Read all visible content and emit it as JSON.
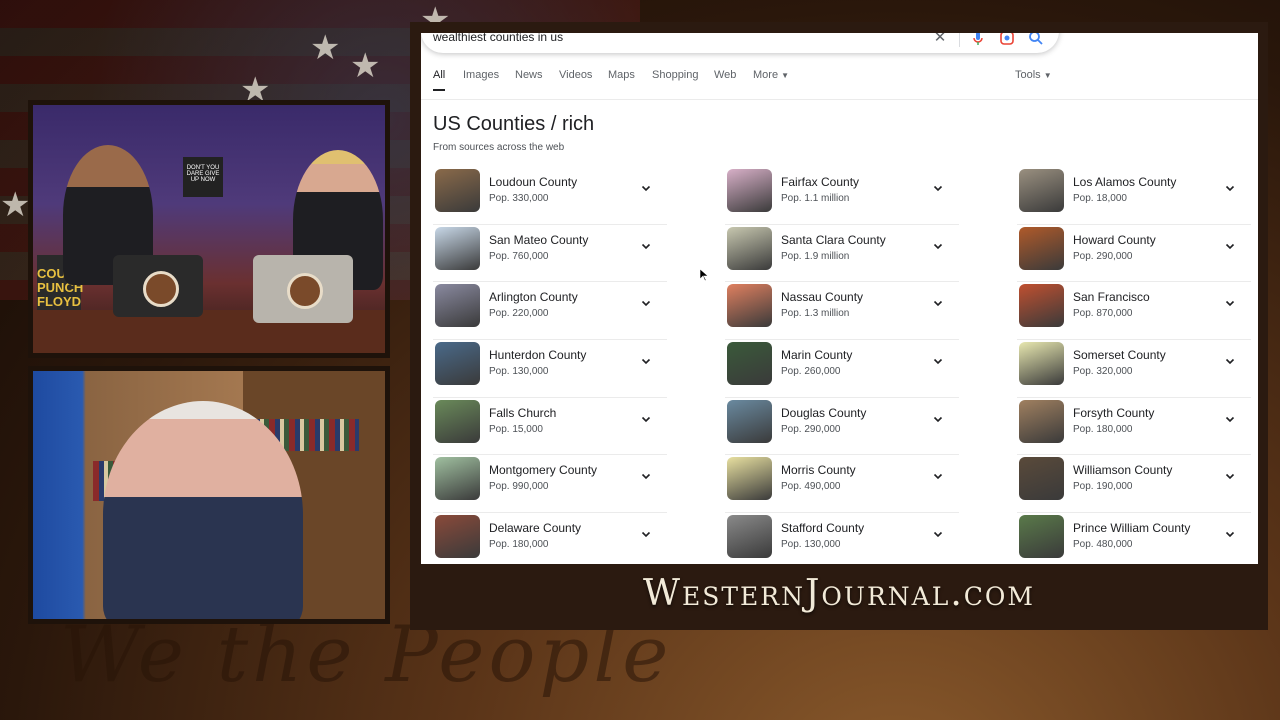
{
  "search": {
    "query": "wealthiest counties in us"
  },
  "tabs": [
    {
      "label": "All"
    },
    {
      "label": "Images"
    },
    {
      "label": "News"
    },
    {
      "label": "Videos"
    },
    {
      "label": "Maps"
    },
    {
      "label": "Shopping"
    },
    {
      "label": "Web"
    },
    {
      "label": "More"
    }
  ],
  "tools_label": "Tools",
  "results": {
    "title": "US Counties / rich",
    "subtitle": "From sources across the web",
    "columns": [
      [
        {
          "name": "Loudoun County",
          "pop": "Pop. 330,000"
        },
        {
          "name": "San Mateo County",
          "pop": "Pop. 760,000"
        },
        {
          "name": "Arlington County",
          "pop": "Pop. 220,000"
        },
        {
          "name": "Hunterdon County",
          "pop": "Pop. 130,000"
        },
        {
          "name": "Falls Church",
          "pop": "Pop. 15,000"
        },
        {
          "name": "Montgomery County",
          "pop": "Pop. 990,000"
        },
        {
          "name": "Delaware County",
          "pop": "Pop. 180,000"
        }
      ],
      [
        {
          "name": "Fairfax County",
          "pop": "Pop. 1.1 million"
        },
        {
          "name": "Santa Clara County",
          "pop": "Pop. 1.9 million"
        },
        {
          "name": "Nassau County",
          "pop": "Pop. 1.3 million"
        },
        {
          "name": "Marin County",
          "pop": "Pop. 260,000"
        },
        {
          "name": "Douglas County",
          "pop": "Pop. 290,000"
        },
        {
          "name": "Morris County",
          "pop": "Pop. 490,000"
        },
        {
          "name": "Stafford County",
          "pop": "Pop. 130,000"
        }
      ],
      [
        {
          "name": "Los Alamos County",
          "pop": "Pop. 18,000"
        },
        {
          "name": "Howard County",
          "pop": "Pop. 290,000"
        },
        {
          "name": "San Francisco",
          "pop": "Pop. 870,000"
        },
        {
          "name": "Somerset County",
          "pop": "Pop. 320,000"
        },
        {
          "name": "Forsyth County",
          "pop": "Pop. 180,000"
        },
        {
          "name": "Williamson County",
          "pop": "Pop. 190,000"
        },
        {
          "name": "Prince William County",
          "pop": "Pop. 480,000"
        }
      ]
    ]
  },
  "overlay": {
    "logo_text": "WesternJournal.com",
    "book_text": "COUNTER PUNCH FLOYD G. BROWN",
    "sign_text": "DON'T YOU DARE GIVE UP NOW"
  }
}
